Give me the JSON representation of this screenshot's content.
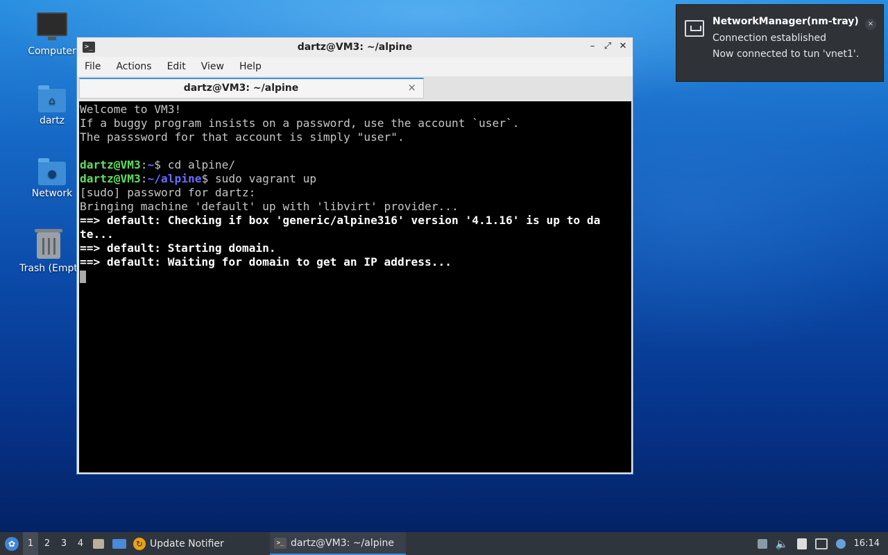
{
  "desktop": {
    "icons": [
      {
        "label": "Computer",
        "icon": "computer-icon"
      },
      {
        "label": "dartz",
        "icon": "home-folder-icon"
      },
      {
        "label": "Network",
        "icon": "network-folder-icon"
      },
      {
        "label": "Trash (Empt",
        "icon": "trash-icon"
      }
    ]
  },
  "window": {
    "title": "dartz@VM3: ~/alpine",
    "menu": [
      "File",
      "Actions",
      "Edit",
      "View",
      "Help"
    ],
    "tab_label": "dartz@VM3: ~/alpine",
    "tab_close": "×",
    "buttons": {
      "minimize": "–",
      "maximize": "⤢",
      "close": "✕"
    },
    "terminal": {
      "welcome": "Welcome to VM3!",
      "line2": "If a buggy program insists on a password, use the account `user`.",
      "line3": "The passsword for that account is simply \"user\".",
      "prompt1_user": "dartz@VM3",
      "prompt1_path": "~",
      "prompt1_cmd": "$ cd alpine/",
      "prompt2_user": "dartz@VM3",
      "prompt2_path": "~/alpine",
      "prompt2_cmd": "$ sudo vagrant up",
      "sudo": "[sudo] password for dartz:",
      "bringing": "Bringing machine 'default' up with 'libvirt' provider...",
      "check1": "==> default: Checking if box 'generic/alpine316' version '4.1.16' is up to da",
      "check2": "te...",
      "starting": "==> default: Starting domain.",
      "waiting": "==> default: Waiting for domain to get an IP address..."
    }
  },
  "notification": {
    "title": "NetworkManager(nm-tray)",
    "body1": "Connection established",
    "body2": "Now connected to tun 'vnet1'.",
    "close": "×"
  },
  "taskbar": {
    "workspaces": [
      "1",
      "2",
      "3",
      "4"
    ],
    "tasks": [
      {
        "label": "Update Notifier",
        "icon": "update-notifier-icon"
      },
      {
        "label": "dartz@VM3: ~/alpine",
        "icon": "terminal-icon"
      }
    ],
    "clock": "16:14"
  }
}
